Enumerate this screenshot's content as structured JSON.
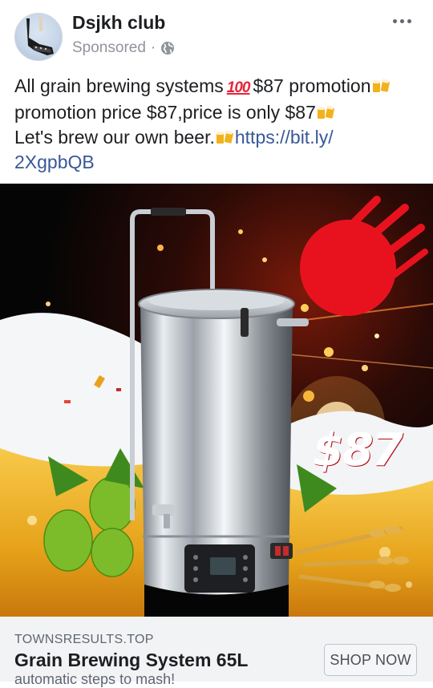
{
  "post": {
    "page_name": "Dsjkh club",
    "sponsored_label": "Sponsored",
    "meta_separator": "·",
    "more_icon": "more-horizontal-icon",
    "privacy_icon": "globe-icon",
    "text_lines": {
      "l1_a": "All grain brewing systems",
      "l1_emoji": "100",
      "l1_b": "$87 promotion",
      "l2": "promotion price $87,price is only $87",
      "l3_text": "Let's brew our own beer.",
      "l3_link": "https://bit.ly/",
      "l4_link": "2XgpbQB"
    }
  },
  "ad_image": {
    "price_badge": "$87",
    "badge_color": "#e8121f"
  },
  "link_card": {
    "domain": "TOWNSRESULTS.TOP",
    "headline": "Grain Brewing System 65L",
    "description": "automatic steps to mash!",
    "cta_label": "SHOP NOW"
  },
  "colors": {
    "link": "#385898",
    "text": "#1c1e21",
    "secondary": "#90949c",
    "card_bg": "#f2f3f5"
  }
}
